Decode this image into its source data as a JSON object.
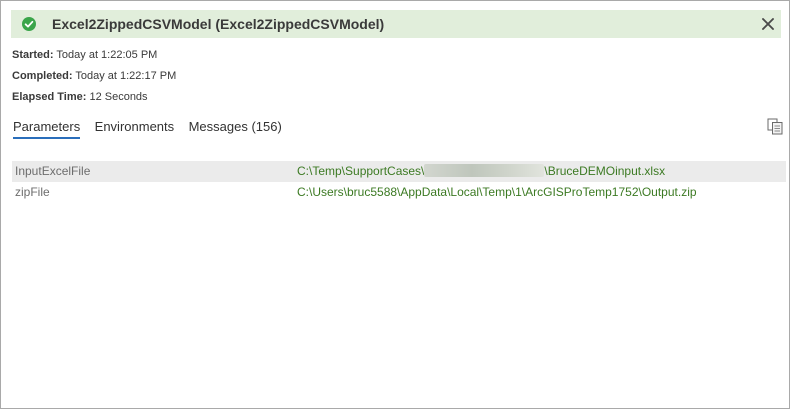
{
  "header": {
    "title": "Excel2ZippedCSVModel (Excel2ZippedCSVModel)"
  },
  "info": {
    "started_label": "Started:",
    "started_value": "Today at 1:22:05 PM",
    "completed_label": "Completed:",
    "completed_value": "Today at 1:22:17 PM",
    "elapsed_label": "Elapsed Time:",
    "elapsed_value": "12 Seconds"
  },
  "tabs": [
    {
      "label": "Parameters"
    },
    {
      "label": "Environments"
    },
    {
      "label": "Messages (156)"
    }
  ],
  "parameters": [
    {
      "name": "InputExcelFile",
      "value_prefix": "C:\\Temp\\SupportCases\\",
      "value_suffix": "\\BruceDEMOinput.xlsx"
    },
    {
      "name": "zipFile",
      "value": "C:\\Users\\bruc5588\\AppData\\Local\\Temp\\1\\ArcGISProTemp1752\\Output.zip"
    }
  ],
  "colors": {
    "header_bg": "#e1eedb",
    "success_green": "#3aa54a",
    "value_green": "#3c7a23",
    "tab_underline": "#2a6ebb",
    "row_alt_bg": "#ebebeb"
  },
  "icons": {
    "status": "check-circle-icon",
    "close": "close-icon",
    "copy": "copy-icon"
  }
}
